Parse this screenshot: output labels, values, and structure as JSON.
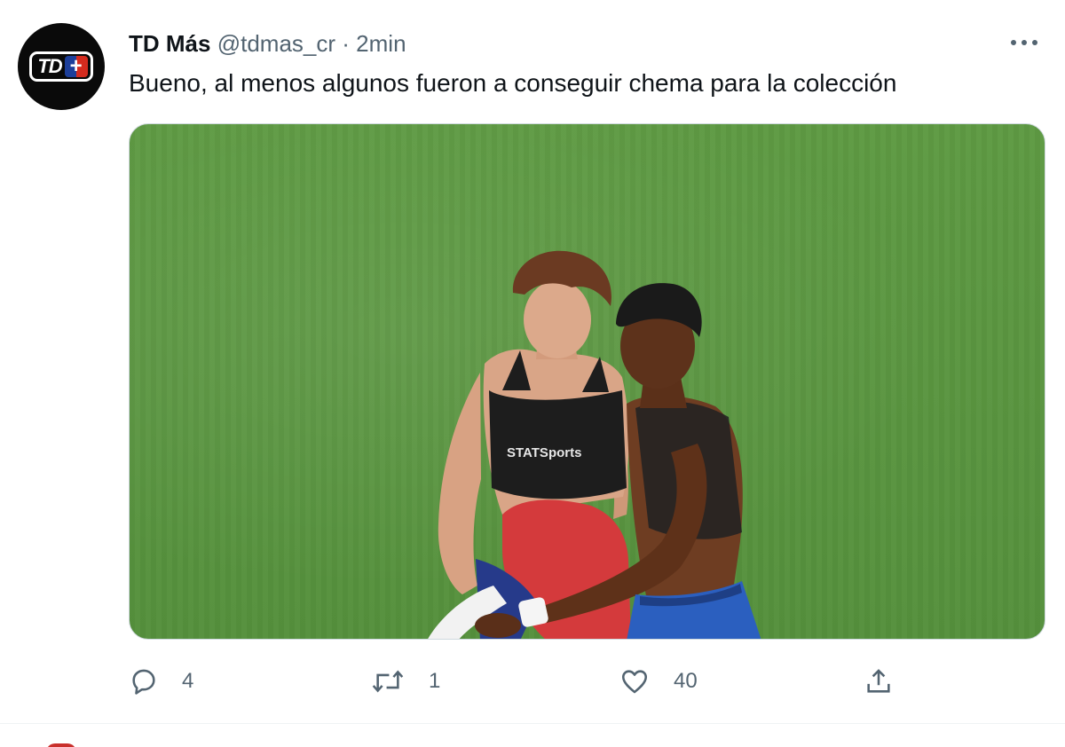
{
  "tweet": {
    "avatar": {
      "logo_text": "TD",
      "logo_plus": "+"
    },
    "display_name": "TD Más",
    "handle": "@tdmas_cr",
    "separator": "·",
    "time": "2min",
    "more_icon": "more-horizontal-icon",
    "text": "Bueno, al menos algunos fueron a conseguir chema para la colección",
    "media": {
      "kind": "photo",
      "shirt_print": "STATSports"
    },
    "actions": {
      "reply": {
        "icon": "reply-icon",
        "count": "4"
      },
      "retweet": {
        "icon": "retweet-icon",
        "count": "1"
      },
      "like": {
        "icon": "heart-icon",
        "count": "40"
      },
      "share": {
        "icon": "share-icon"
      }
    }
  },
  "colors": {
    "text_primary": "#0f1419",
    "text_secondary": "#536471",
    "pitch_green": "#5a9540",
    "divider": "#eff3f4"
  }
}
